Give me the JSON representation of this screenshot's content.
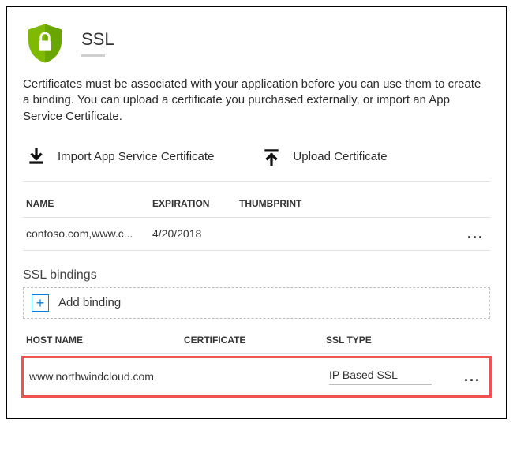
{
  "header": {
    "title": "SSL"
  },
  "description": "Certificates must be associated with your application before you can use them to create a binding. You can upload a certificate you purchased externally, or import an App Service Certificate.",
  "actions": {
    "import_label": "Import App Service Certificate",
    "upload_label": "Upload Certificate"
  },
  "cert_table": {
    "headers": {
      "name": "NAME",
      "expiration": "EXPIRATION",
      "thumbprint": "THUMBPRINT"
    },
    "rows": [
      {
        "name": "contoso.com,www.c...",
        "expiration": "4/20/2018",
        "thumbprint": ""
      }
    ]
  },
  "bindings_section": {
    "title": "SSL bindings",
    "add_label": "Add binding",
    "headers": {
      "host": "HOST NAME",
      "certificate": "CERTIFICATE",
      "ssl_type": "SSL TYPE"
    },
    "rows": [
      {
        "host": "www.northwindcloud.com",
        "certificate": "",
        "ssl_type": "IP Based SSL"
      }
    ]
  },
  "glyphs": {
    "ellipsis": "..."
  }
}
